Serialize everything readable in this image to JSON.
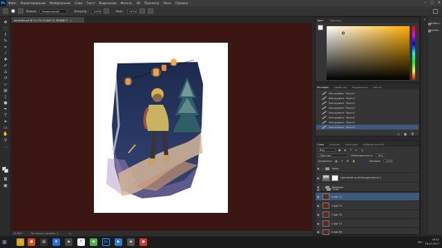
{
  "app": {
    "logo": "Ps"
  },
  "menu": [
    "Файл",
    "Редактирование",
    "Изображение",
    "Слои",
    "Текст",
    "Выделение",
    "Фильтр",
    "3D",
    "Просмотр",
    "Окно",
    "Справка"
  ],
  "window_controls": [
    "–",
    "▢",
    "✕"
  ],
  "options": {
    "mode_label": "Режим:",
    "mode_value": "Нормальный",
    "opacity_label": "Непрозр.:",
    "opacity_value": "100%",
    "flow_label": "Наж.:",
    "flow_value": "100%"
  },
  "document": {
    "tab_title": "лесной.psd @ 11,7% (Слой 71, RGB/8) *",
    "tab_close": "×"
  },
  "status": {
    "zoom": "11,69%",
    "doc_info": "Эк.печать: размер: 1,...",
    "arrow": "▸"
  },
  "toolbar_icons": [
    "move-icon",
    "marquee-icon",
    "lasso-icon",
    "quick-select-icon",
    "crop-icon",
    "eyedropper-icon",
    "healing-icon",
    "brush-icon",
    "clone-stamp-icon",
    "history-brush-icon",
    "eraser-icon",
    "gradient-icon",
    "blur-icon",
    "dodge-icon",
    "pen-icon",
    "type-icon",
    "path-select-icon",
    "shape-icon",
    "hand-icon",
    "zoom-icon"
  ],
  "right_strip": {
    "items": [
      {
        "label": "Библи...",
        "icon": "libraries-icon"
      },
      {
        "label": "Свойс...",
        "icon": "properties-icon"
      }
    ]
  },
  "color_panel": {
    "tabs": [
      "Цвет",
      "Образцы"
    ]
  },
  "history_panel": {
    "tabs": [
      "История",
      "Свойства",
      "Коррекция",
      "Кисти"
    ],
    "items": [
      "Инструмент \"Кисть\"",
      "Инструмент \"Кисть\"",
      "Инструмент \"Кисть\"",
      "Инструмент \"Кисть\"",
      "Инструмент \"Кисть\"",
      "Инструмент \"Кисть\"",
      "Инструмент \"Кисть\"",
      "Инструмент \"Кисть\""
    ],
    "selected_index": 7
  },
  "layers_panel": {
    "tabs": [
      "Слои",
      "Каналы",
      "Контуры",
      "Наборы кистей"
    ],
    "filter_label": "Вид",
    "blend_mode": "Обычные",
    "opacity_label": "Непрозрачность:",
    "opacity_value": "40%",
    "lock_label": "Закрепить:",
    "fill_label": "Заливка:",
    "fill_value": "100%",
    "layers": [
      {
        "name": "Лайн",
        "type": "folder"
      },
      {
        "name": "Цветовой тон/Насыщенность 1",
        "type": "adjustment"
      },
      {
        "name": "Девушка",
        "type": "folder"
      },
      {
        "name": "Снег",
        "type": "folder"
      },
      {
        "name": "Слой 71",
        "type": "layer",
        "selected": true
      },
      {
        "name": "Слой 73",
        "type": "layer"
      },
      {
        "name": "Слой 70",
        "type": "layer"
      },
      {
        "name": "Слой 72",
        "type": "layer"
      },
      {
        "name": "Слой 69",
        "type": "layer"
      }
    ]
  },
  "taskbar": {
    "apps": [
      {
        "icon": "explorer-icon",
        "color": "#d8a21c",
        "glyph": "▭"
      },
      {
        "icon": "browser-icon",
        "color": "#e0481f",
        "glyph": "●"
      },
      {
        "icon": "yandex-icon",
        "color": "#ffffff",
        "glyph": "Y"
      },
      {
        "icon": "chrome-icon",
        "color": "#4caf50",
        "glyph": "◉"
      },
      {
        "icon": "photoshop-icon",
        "color": "#001e36",
        "glyph": "Ps"
      },
      {
        "icon": "player-icon",
        "color": "#2a7ed8",
        "glyph": "▶"
      },
      {
        "icon": "media-icon",
        "color": "#555555",
        "glyph": "◈"
      },
      {
        "icon": "camera-icon",
        "color": "#d33",
        "glyph": "●"
      }
    ],
    "language": "РУС",
    "time": "16:22",
    "date": "28.10.2017"
  }
}
